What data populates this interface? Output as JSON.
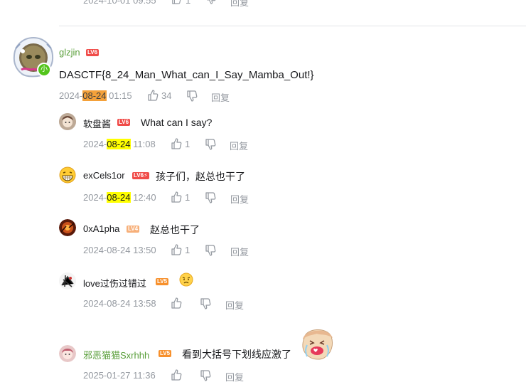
{
  "top_row": {
    "date": "2024-10-01 09:55",
    "likes": "1",
    "reply": "回复"
  },
  "main": {
    "user": "glzjin",
    "level": "LV6",
    "level_color": "#f04c49",
    "name_color": "#5a9f3b",
    "badge": "小",
    "content": "DASCTF{8_24_Man_What_can_I_Say_Mamba_Out!}",
    "date_prefix": "2024-",
    "date_highlight": "08-24",
    "date_suffix": " 01:15",
    "likes": "34",
    "reply": "回复"
  },
  "replies": [
    {
      "user": "软盘酱",
      "level": "LV6",
      "level_color": "#f04c49",
      "text": "What can I say?",
      "date_prefix": "2024-",
      "date_highlight": "08-24",
      "date_suffix": " 11:08",
      "likes": "1",
      "reply": "回复"
    },
    {
      "user": "exCels1or",
      "level": "LV6⚡",
      "level_color": "#f04c49",
      "text": "孩子们，赵总也干了",
      "date_prefix": "2024-",
      "date_highlight": "08-24",
      "date_suffix": " 12:40",
      "likes": "1",
      "reply": "回复"
    },
    {
      "user": "0xA1pha",
      "level": "LV4",
      "level_color": "#f7b07a",
      "text": "赵总也干了",
      "date": "2024-08-24 13:50",
      "likes": "1",
      "reply": "回复"
    },
    {
      "user": "love过伤过错过",
      "level": "LV5",
      "level_color": "#f7902c",
      "text": "",
      "emoji": "face-emoji",
      "date": "2024-08-24 13:58",
      "reply": "回复"
    },
    {
      "user": "邪恶猫猫Sxrhhh",
      "level": "LV5",
      "level_color": "#f7902c",
      "name_color": "#5a9f3b",
      "text": "看到大括号下划线应激了",
      "date": "2025-01-27 11:36",
      "reply": "回复"
    }
  ],
  "icons": {
    "like": "thumbs-up-icon",
    "dislike": "thumbs-down-icon"
  }
}
